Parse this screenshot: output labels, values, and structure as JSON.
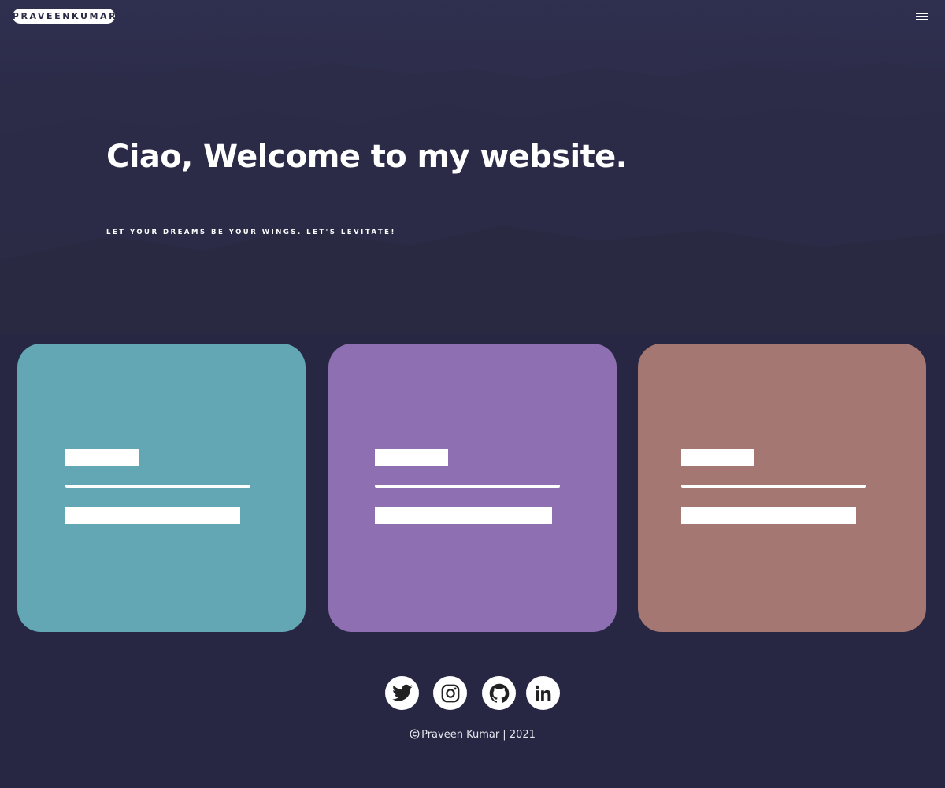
{
  "header": {
    "logo_text": "PRAVEENKUMAR",
    "menu_icon": "hamburger-menu-icon"
  },
  "hero": {
    "title": "Ciao, Welcome to my website.",
    "tagline": "LET YOUR DREAMS BE YOUR WINGS. LET'S LEVITATE!"
  },
  "cards": [
    {
      "color": "#63a6b4"
    },
    {
      "color": "#8e6fb1"
    },
    {
      "color": "#a47772"
    }
  ],
  "social": [
    {
      "name": "twitter",
      "icon": "twitter-icon"
    },
    {
      "name": "instagram",
      "icon": "instagram-icon"
    },
    {
      "name": "github",
      "icon": "github-icon"
    },
    {
      "name": "linkedin",
      "icon": "linkedin-icon"
    }
  ],
  "footer": {
    "copyright_icon": "copyright-icon",
    "text": "Praveen Kumar | 2021"
  },
  "colors": {
    "background": "#272743",
    "hero_overlay": "#2a2a47",
    "card_teal": "#63a6b4",
    "card_purple": "#8e6fb1",
    "card_rose": "#a47772"
  }
}
